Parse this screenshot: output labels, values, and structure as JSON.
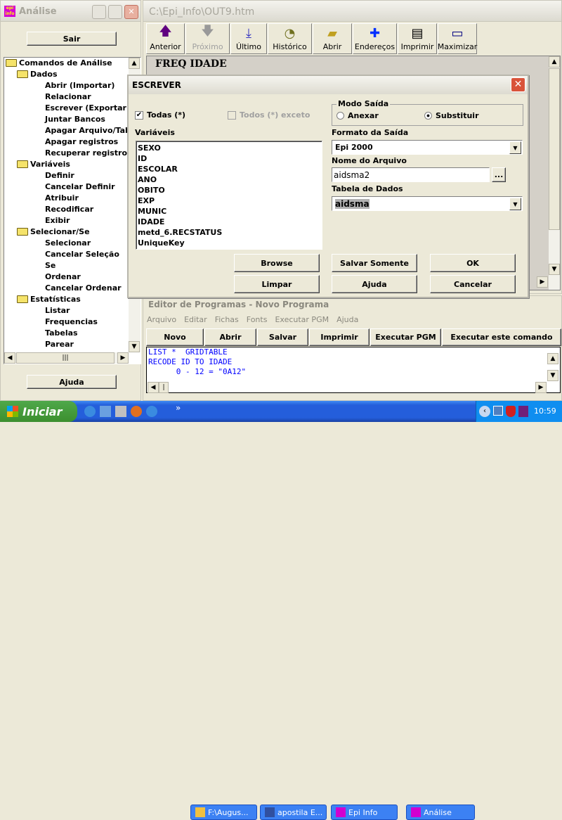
{
  "left_window": {
    "title": "Análise",
    "sair": "Sair",
    "ajuda": "Ajuda",
    "tree": [
      {
        "label": "Comandos de Análise",
        "level": 0,
        "folder": true
      },
      {
        "label": "Dados",
        "level": 1,
        "folder": true
      },
      {
        "label": "Abrir (Importar)",
        "level": 2
      },
      {
        "label": "Relacionar",
        "level": 2
      },
      {
        "label": "Escrever (Exportar)",
        "level": 2
      },
      {
        "label": "Juntar Bancos",
        "level": 2
      },
      {
        "label": "Apagar Arquivo/Tab",
        "level": 2
      },
      {
        "label": "Apagar registros",
        "level": 2
      },
      {
        "label": "Recuperar registros",
        "level": 2
      },
      {
        "label": "Variáveis",
        "level": 1,
        "folder": true
      },
      {
        "label": "Definir",
        "level": 2
      },
      {
        "label": "Cancelar Definir",
        "level": 2
      },
      {
        "label": "Atribuir",
        "level": 2
      },
      {
        "label": "Recodificar",
        "level": 2
      },
      {
        "label": "Exibir",
        "level": 2
      },
      {
        "label": "Selecionar/Se",
        "level": 1,
        "folder": true
      },
      {
        "label": "Selecionar",
        "level": 2
      },
      {
        "label": "Cancelar Seleção",
        "level": 2
      },
      {
        "label": "Se",
        "level": 2
      },
      {
        "label": "Ordenar",
        "level": 2
      },
      {
        "label": "Cancelar Ordenar",
        "level": 2
      },
      {
        "label": "Estatísticas",
        "level": 1,
        "folder": true
      },
      {
        "label": "Listar",
        "level": 2
      },
      {
        "label": "Frequencias",
        "level": 2
      },
      {
        "label": "Tabelas",
        "level": 2
      },
      {
        "label": "Parear",
        "level": 2
      }
    ]
  },
  "output_window": {
    "title": "C:\\Epi_Info\\OUT9.htm",
    "toolbar": [
      {
        "label": "Anterior",
        "icon": "arrow-up-icon",
        "enabled": true
      },
      {
        "label": "Próximo",
        "icon": "arrow-down-icon",
        "enabled": false
      },
      {
        "label": "Último",
        "icon": "arrow-last-icon",
        "enabled": true
      },
      {
        "label": "Histórico",
        "icon": "history-icon",
        "enabled": true
      },
      {
        "label": "Abrir",
        "icon": "open-folder-icon",
        "enabled": true
      },
      {
        "label": "Endereços",
        "icon": "bookmark-icon",
        "enabled": true
      },
      {
        "label": "Imprimir",
        "icon": "printer-icon",
        "enabled": true
      },
      {
        "label": "Maximizar",
        "icon": "maximize-icon",
        "enabled": true
      }
    ],
    "content_heading": "FREQ IDADE"
  },
  "editor": {
    "title": "Editor de Programas - Novo Programa",
    "menu": [
      "Arquivo",
      "Editar",
      "Fichas",
      "Fonts",
      "Executar PGM",
      "Ajuda"
    ],
    "buttons": [
      "Novo",
      "Abrir",
      "Salvar",
      "Imprimir",
      "Executar PGM",
      "Executar este comando"
    ],
    "code": [
      "LIST *  GRIDTABLE",
      "RECODE ID TO IDADE",
      "      0 - 12 = \"0A12\""
    ]
  },
  "dialog": {
    "title": "ESCREVER",
    "todas": "Todas (*)",
    "todas_checked": true,
    "todos_exceto": "Todos (*) exceto",
    "todos_exceto_checked": false,
    "variaveis_label": "Variáveis",
    "variaveis": [
      "SEXO",
      "ID",
      "ESCOLAR",
      "ANO",
      "OBITO",
      "EXP",
      "MUNIC",
      "IDADE",
      "metd_6.RECSTATUS",
      "UniqueKey"
    ],
    "modo_saida": "Modo Saída",
    "anexar": "Anexar",
    "substituir": "Substituir",
    "modo_selected": "Substituir",
    "formato_label": "Formato da Saída",
    "formato_value": "Epi 2000",
    "nome_label": "Nome do Arquivo",
    "nome_value": "aidsma2",
    "browse_dots": "...",
    "tabela_label": "Tabela de Dados",
    "tabela_value": "aidsma",
    "buttons": {
      "browse": "Browse",
      "salvar": "Salvar Somente",
      "ok": "OK",
      "limpar": "Limpar",
      "ajuda": "Ajuda",
      "cancelar": "Cancelar"
    }
  },
  "taskbar": {
    "start": "Iniciar",
    "more": "»",
    "tasks": [
      "F:\\Augus...",
      "apostila E...",
      "Epi Info",
      "Análise"
    ],
    "clock": "10:59"
  }
}
